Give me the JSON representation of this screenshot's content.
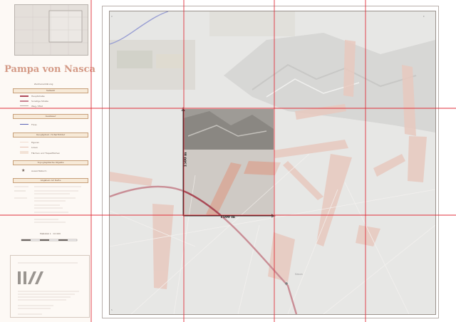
{
  "title": "Pampa von Nasca",
  "legend": {
    "header_top": "Zeichenerklärung",
    "section1": "Verkehr",
    "items1": [
      "Hauptstraße",
      "Sonstige Straße",
      "Weg / Pfad"
    ],
    "section2": "Gewässer",
    "items2": [
      "Fluss"
    ],
    "section3": "Geoglyphen / Scharrbilder",
    "items3": [
      "Figuren",
      "Linien",
      "Flächen und Trapezflächen"
    ],
    "section4": "Topographische Objekte",
    "items4": [
      "Aussichtsturm"
    ],
    "section5": "Angaben zur Karte",
    "scale_label": "Maßstab 1 : 10 000"
  },
  "map": {
    "measure_vertical": "1500 m",
    "measure_horizontal": "1500 m",
    "place_label": "Nasca"
  },
  "colors": {
    "grid_line": "#e0313c",
    "measure": "#111111",
    "line_fill": "#d9a898",
    "road": "#a94a56",
    "title": "#d49a86"
  }
}
